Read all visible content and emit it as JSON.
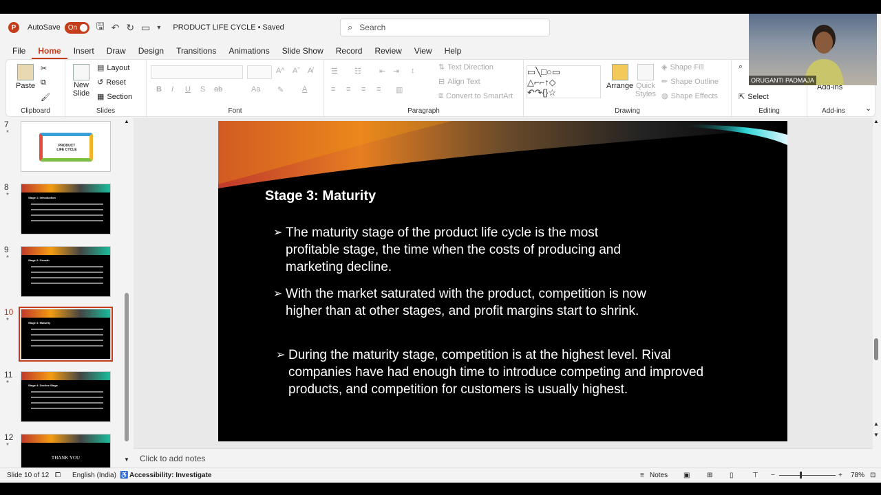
{
  "titlebar": {
    "autosave_label": "AutoSave",
    "autosave_state": "On",
    "doc_title": "PRODUCT LIFE CYCLE • Saved",
    "search_placeholder": "Search"
  },
  "menu": [
    "File",
    "Home",
    "Insert",
    "Draw",
    "Design",
    "Transitions",
    "Animations",
    "Slide Show",
    "Record",
    "Review",
    "View",
    "Help"
  ],
  "ribbon": {
    "clipboard": {
      "label": "Clipboard",
      "paste": "Paste"
    },
    "slides": {
      "label": "Slides",
      "new_slide": "New Slide",
      "layout": "Layout",
      "reset": "Reset",
      "section": "Section"
    },
    "font": {
      "label": "Font",
      "bold": "B",
      "italic": "I",
      "underline": "U",
      "shadow": "S",
      "strike": "ab",
      "case": "Aa"
    },
    "paragraph": {
      "label": "Paragraph",
      "text_direction": "Text Direction",
      "align_text": "Align Text",
      "smartart": "Convert to SmartArt"
    },
    "drawing": {
      "label": "Drawing",
      "arrange": "Arrange",
      "quick_styles": "Quick Styles",
      "shape_fill": "Shape Fill",
      "shape_outline": "Shape Outline",
      "shape_effects": "Shape Effects"
    },
    "editing": {
      "label": "Editing",
      "select": "Select"
    },
    "addins": {
      "label": "Add-ins",
      "addins": "Add-ins"
    }
  },
  "thumbnails": [
    {
      "num": "7",
      "title": "PRODUCT LIFE CYCLE"
    },
    {
      "num": "8",
      "title": "Stage 1: Introduction"
    },
    {
      "num": "9",
      "title": "Stage 2: Growth"
    },
    {
      "num": "10",
      "title": "Stage 3: Maturity"
    },
    {
      "num": "11",
      "title": "Stage 4: Decline Stage"
    },
    {
      "num": "12",
      "title": "THANK YOU"
    }
  ],
  "slide": {
    "title": "Stage 3: Maturity",
    "bullets": [
      "The maturity stage of the product life cycle is the most profitable stage, the time when the costs of producing and marketing decline.",
      "With the market saturated with the product, competition is now higher than at other stages, and profit margins start to shrink.",
      "During the maturity stage, competition is at the highest level. Rival companies have had enough time to introduce competing and improved products, and competition for customers is usually highest."
    ]
  },
  "notes_placeholder": "Click to add notes",
  "status": {
    "slide_info": "Slide 10 of 12",
    "language": "English (India)",
    "accessibility": "Accessibility: Investigate",
    "notes": "Notes",
    "zoom": "78%"
  },
  "webcam": {
    "name": "ORUGANTI PADMAJA"
  },
  "colors": {
    "accent": "#c43e1c",
    "slide_bg": "#000000"
  }
}
